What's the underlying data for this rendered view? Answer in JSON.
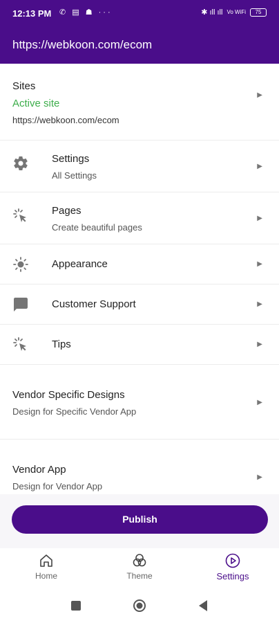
{
  "status": {
    "time": "12:13 PM",
    "left_icons": "✆ ▤ ☗  ···",
    "right_icons": "✱ ıll ıll",
    "network": "Vo WiFi",
    "battery": "75"
  },
  "appbar": {
    "title": "https://webkoon.com/ecom"
  },
  "sites": {
    "title": "Sites",
    "status": "Active site",
    "url": "https://webkoon.com/ecom"
  },
  "menu": {
    "settings": {
      "title": "Settings",
      "subtitle": "All Settings",
      "icon": "gear-icon"
    },
    "pages": {
      "title": "Pages",
      "subtitle": "Create beautiful pages",
      "icon": "cursor-click-icon"
    },
    "appearance": {
      "title": "Appearance",
      "icon": "brightness-icon"
    },
    "support": {
      "title": "Customer Support",
      "icon": "chat-icon"
    },
    "tips": {
      "title": "Tips",
      "icon": "cursor-click-icon"
    }
  },
  "vendor_specific": {
    "title": "Vendor Specific Designs",
    "subtitle": "Design for Specific Vendor App"
  },
  "vendor_app": {
    "title": "Vendor App",
    "subtitle": "Design for Vendor App"
  },
  "publish_label": "Publish",
  "nav": {
    "home": "Home",
    "theme": "Theme",
    "settings": "Settings"
  },
  "colors": {
    "primary": "#4a0d8a",
    "active_green": "#3dae4b"
  }
}
